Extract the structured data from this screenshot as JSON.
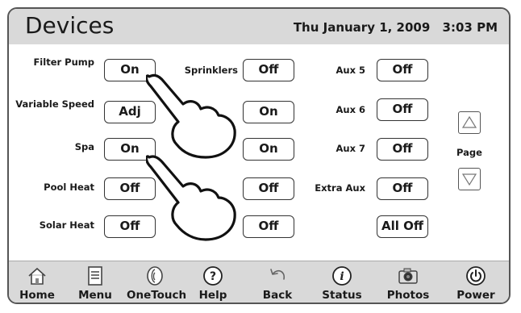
{
  "header": {
    "title": "Devices",
    "date": "Thu January 1, 2009",
    "time": "3:03 PM"
  },
  "devices": {
    "col1": [
      {
        "label": "Filter Pump",
        "value": "On"
      },
      {
        "label": "Variable Speed",
        "value": "Adj"
      },
      {
        "label": "Spa",
        "value": "On"
      },
      {
        "label": "Pool Heat",
        "value": "Off"
      },
      {
        "label": "Solar Heat",
        "value": "Off"
      }
    ],
    "col2": [
      {
        "label": "Sprinklers",
        "value": "Off"
      },
      {
        "label": "",
        "value": "On"
      },
      {
        "label": "",
        "value": "On"
      },
      {
        "label": "",
        "value": "Off"
      },
      {
        "label": "",
        "value": "Off"
      }
    ],
    "col3": [
      {
        "label": "Aux 5",
        "value": "Off"
      },
      {
        "label": "Aux 6",
        "value": "Off"
      },
      {
        "label": "Aux 7",
        "value": "Off"
      },
      {
        "label": "Extra Aux",
        "value": "Off"
      },
      {
        "label": "",
        "value": "All Off"
      }
    ]
  },
  "paging": {
    "label": "Page",
    "up_icon": "triangle-up-icon",
    "down_icon": "triangle-down-icon"
  },
  "nav": [
    {
      "label": "Home",
      "icon": "home-icon"
    },
    {
      "label": "Menu",
      "icon": "menu-icon"
    },
    {
      "label": "OneTouch",
      "icon": "onetouch-icon"
    },
    {
      "label": "Help",
      "icon": "help-icon"
    },
    {
      "label": "Back",
      "icon": "back-icon"
    },
    {
      "label": "Status",
      "icon": "status-icon"
    },
    {
      "label": "Photos",
      "icon": "camera-icon"
    },
    {
      "label": "Power",
      "icon": "power-icon"
    }
  ]
}
